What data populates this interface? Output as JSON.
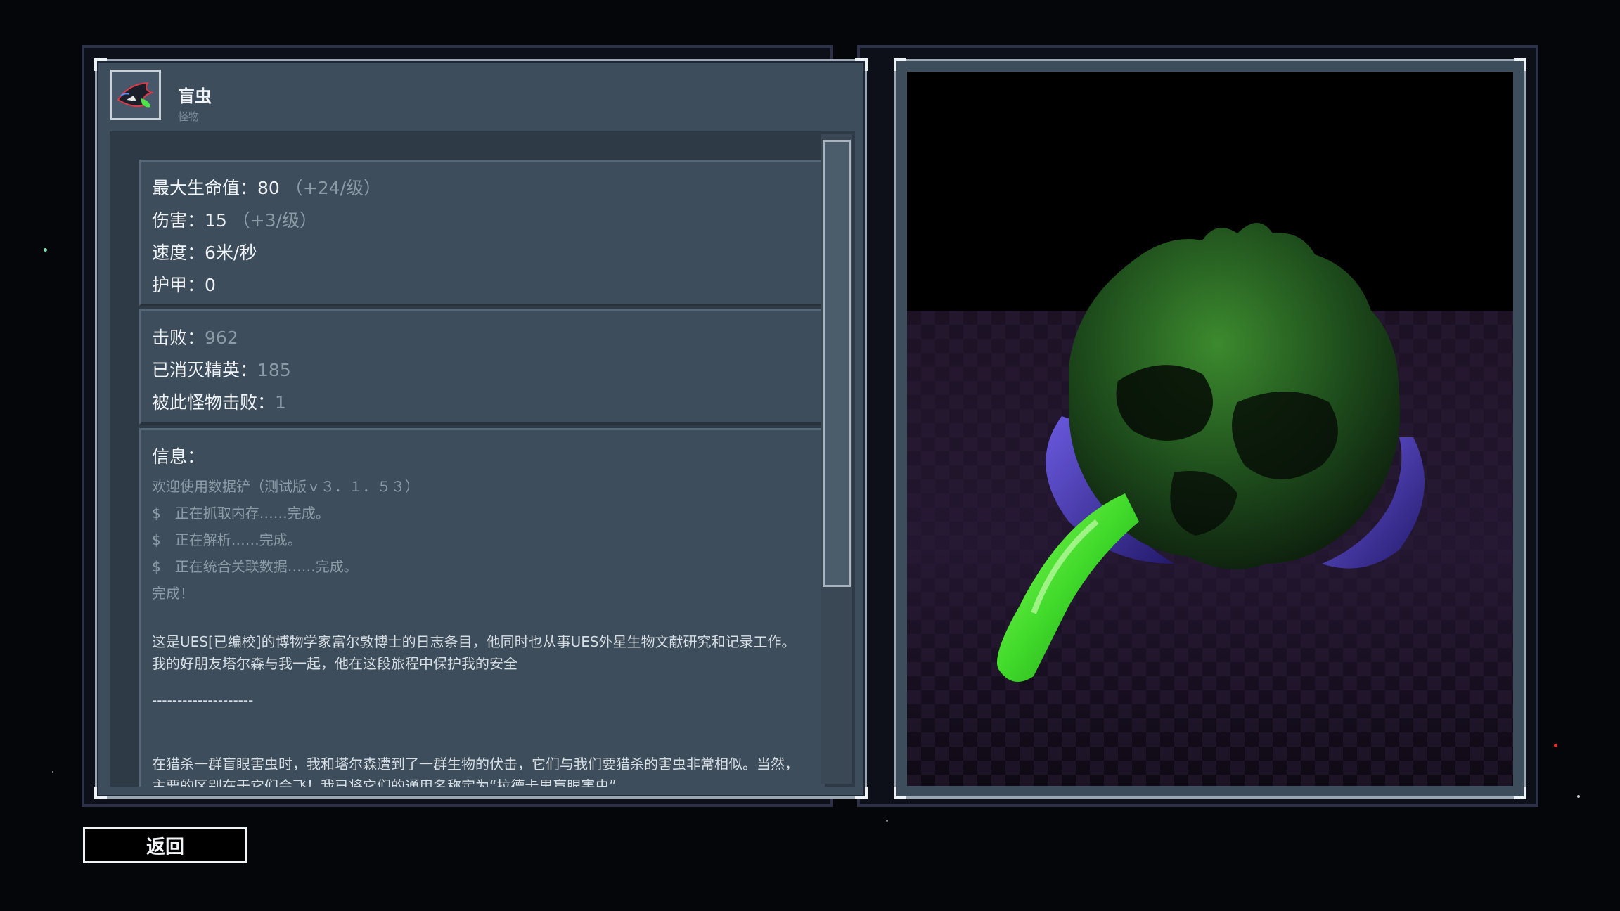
{
  "monster": {
    "name": "盲虫",
    "category": "怪物",
    "portrait_icon": "blind-worm-icon"
  },
  "stats": {
    "max_hp_label": "最大生命值：",
    "max_hp_value": "80",
    "max_hp_scaling": "（+24/级）",
    "damage_label": "伤害：",
    "damage_value": "15",
    "damage_scaling": "（+3/级）",
    "speed_label": "速度：",
    "speed_value": "6米/秒",
    "armor_label": "护甲：",
    "armor_value": "0"
  },
  "records": {
    "kills_label": "击败：",
    "kills_value": "962",
    "elites_label": "已消灭精英：",
    "elites_value": "185",
    "deaths_label": "被此怪物击败：",
    "deaths_value": "1"
  },
  "info": {
    "heading": "信息：",
    "lines": [
      "欢迎使用数据铲（测试版ｖ３．１．５３）",
      "$　正在抓取内存……完成。",
      "$　正在解析……完成。",
      "$　正在统合关联数据……完成。",
      "完成！"
    ],
    "paragraph1": "这是UES[已编校]的博物学家富尔敦博士的日志条目，他同时也从事UES外星生物文献研究和记录工作。我的好朋友塔尔森与我一起，他在这段旅程中保护我的安全",
    "divider": "--------------------",
    "paragraph2": "在猎杀一群盲眼害虫时，我和塔尔森遭到了一群生物的伏击，它们与我们要猎杀的害虫非常相似。当然，主要的区别在于它们会飞！我已将它们的通用名称定为“拉德卡里盲眼害虫”"
  },
  "buttons": {
    "back_label": "返回"
  },
  "colors": {
    "panel": "#3d4d5c",
    "content_bg": "#2e3b47",
    "dim_text": "#8d9aa7",
    "model_green": "#3fd92a",
    "model_purple": "#4b3aa8"
  }
}
